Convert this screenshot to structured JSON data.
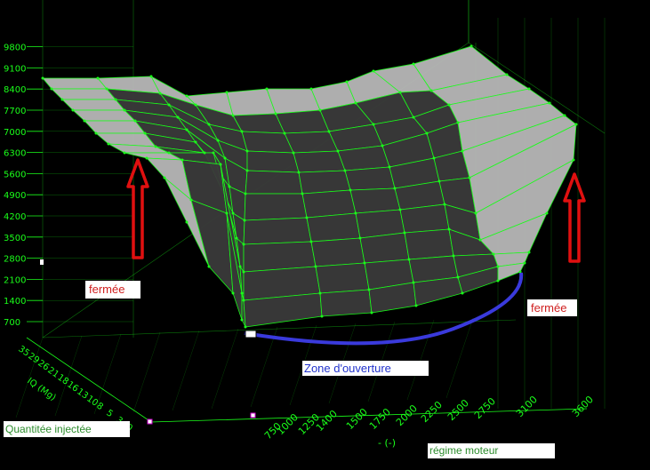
{
  "chart_data": {
    "type": "surface",
    "title": "",
    "z_ticks": [
      "700",
      "1400",
      "2100",
      "2800",
      "3500",
      "4200",
      "4900",
      "5600",
      "6300",
      "7000",
      "7700",
      "8400",
      "9100",
      "9800"
    ],
    "x_axis_label": "régime moteur",
    "x_unit": "- (-)",
    "x_ticks": [
      "750",
      "1000",
      "1250",
      "1400",
      "1500",
      "1750",
      "2000",
      "2250",
      "2500",
      "2750",
      "3100",
      "3600"
    ],
    "y_axis_label": "Quantitée injectée",
    "y_unit": "IQ (Mg)",
    "y_ticks": [
      "35",
      "29",
      "26",
      "21",
      "18",
      "16",
      "13",
      "10",
      "8",
      "5",
      "3",
      "0"
    ],
    "annotations": {
      "closed_left": "fermée",
      "closed_right": "fermée",
      "opening_zone": "Zone d'ouverture"
    }
  },
  "colors": {
    "grid": "#1aff1a",
    "surface_dark": "#3a3a3a",
    "surface_light": "#b8b8b8",
    "arrow": "#e01010",
    "opening_curve": "#3a3adc",
    "label_red": "#d02020",
    "label_blue": "#2233cc",
    "label_green": "#2c8c2c"
  }
}
